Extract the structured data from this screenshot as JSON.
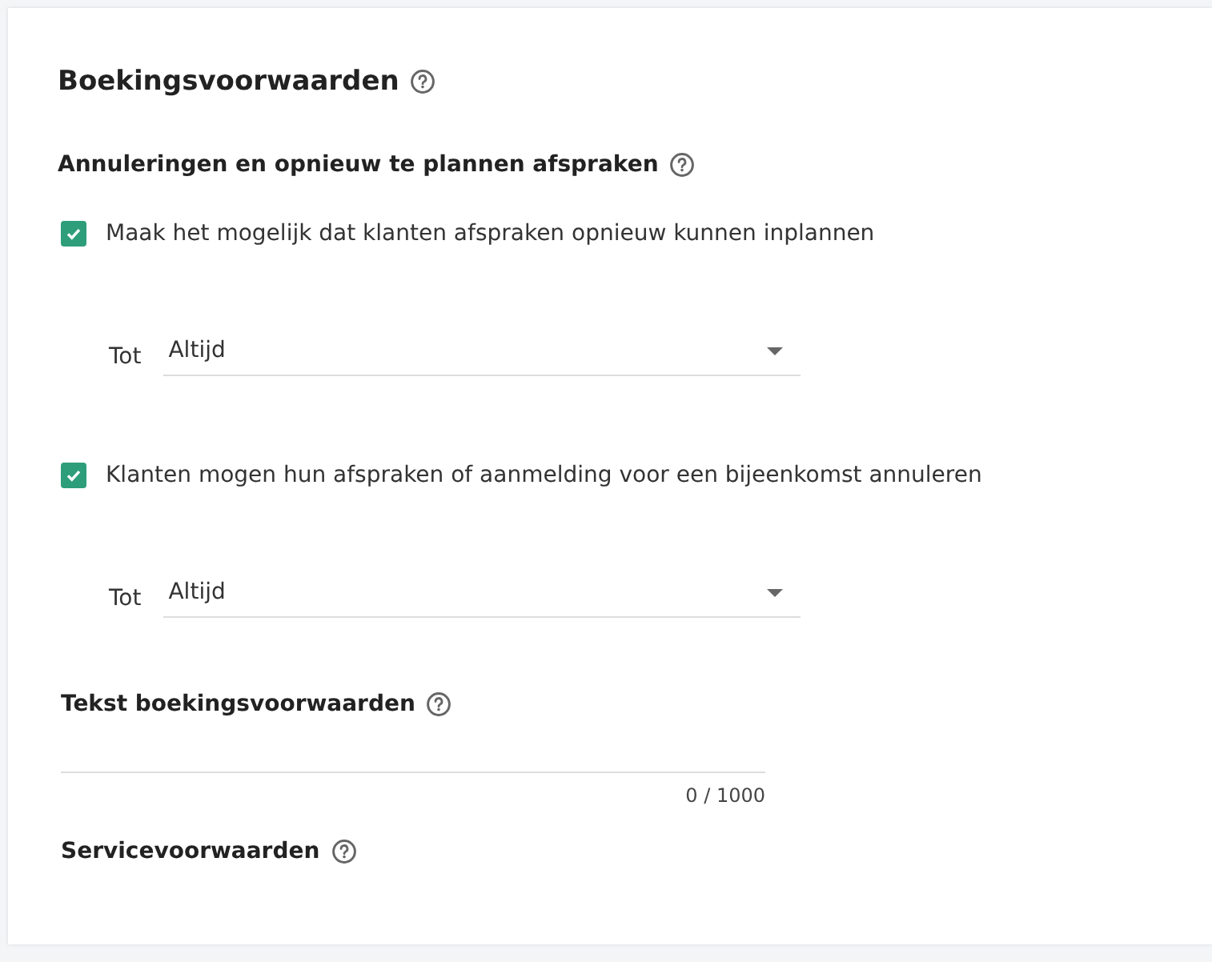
{
  "title": {
    "text": "Boekingsvoorwaarden"
  },
  "cancellation": {
    "heading": "Annuleringen en opnieuw te plannen afspraken",
    "options": [
      {
        "label": "Maak het mogelijk dat klanten afspraken opnieuw kunnen inplannen",
        "checked": true,
        "select_label": "Tot",
        "select_value": "Altijd"
      },
      {
        "label": "Klanten mogen hun afspraken of aanmelding voor een bijeenkomst annuleren",
        "checked": true,
        "select_label": "Tot",
        "select_value": "Altijd"
      }
    ]
  },
  "terms_text": {
    "heading": "Tekst boekingsvoorwaarden",
    "counter": "0 / 1000"
  },
  "service_terms": {
    "heading": "Servicevoorwaarden"
  }
}
